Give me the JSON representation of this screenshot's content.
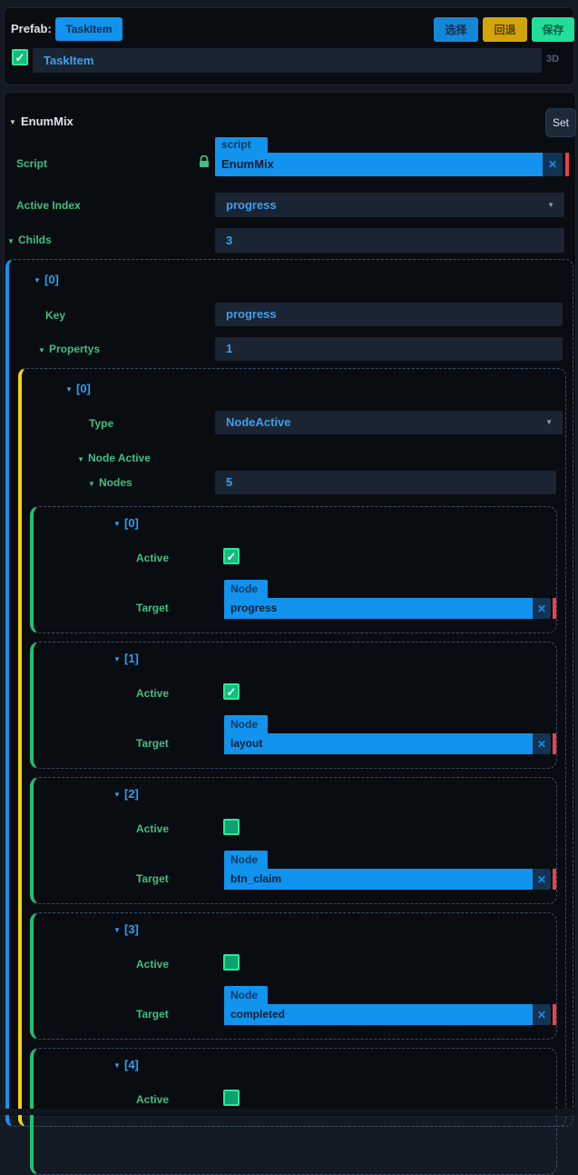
{
  "colors": {
    "accent_blue": "#1193ee",
    "label_green": "#41bf83",
    "value_blue": "#3f9fe9",
    "bar_blue": "#1193ee",
    "bar_yellow": "#f2d410",
    "bar_green": "#22c06e",
    "clear_red": "#ee4141",
    "btn_select_blue": "#1587d8",
    "btn_revert_gold": "#d3a40a",
    "btn_save_green": "#21df99"
  },
  "header": {
    "prefab_label": "Prefab:",
    "prefab_name": "TaskItem",
    "buttons": {
      "select": "选择",
      "revert": "回退",
      "save": "保存"
    },
    "node": {
      "name": "TaskItem",
      "checked": true,
      "badge": "3D"
    }
  },
  "component": {
    "name": "EnumMix",
    "set_button": "Set",
    "script": {
      "label": "Script",
      "tag": "script",
      "value": "EnumMix"
    },
    "active_index": {
      "label": "Active Index",
      "value": "progress"
    },
    "childs": {
      "label": "Childs",
      "count": "3"
    }
  },
  "child0": {
    "index_label": "[0]",
    "key": {
      "label": "Key",
      "value": "progress"
    },
    "propertys": {
      "label": "Propertys",
      "count": "1"
    },
    "property0": {
      "index_label": "[0]",
      "type": {
        "label": "Type",
        "value": "NodeActive"
      },
      "node_active_label": "Node Active",
      "nodes": {
        "label": "Nodes",
        "count": "5"
      },
      "items": [
        {
          "index_label": "[0]",
          "active_label": "Active",
          "active": true,
          "target_label": "Target",
          "target_tag": "Node",
          "target_value": "progress"
        },
        {
          "index_label": "[1]",
          "active_label": "Active",
          "active": true,
          "target_label": "Target",
          "target_tag": "Node",
          "target_value": "layout"
        },
        {
          "index_label": "[2]",
          "active_label": "Active",
          "active": false,
          "target_label": "Target",
          "target_tag": "Node",
          "target_value": "btn_claim"
        },
        {
          "index_label": "[3]",
          "active_label": "Active",
          "active": false,
          "target_label": "Target",
          "target_tag": "Node",
          "target_value": "completed"
        },
        {
          "index_label": "[4]",
          "active_label": "Active",
          "active": false
        }
      ]
    }
  }
}
